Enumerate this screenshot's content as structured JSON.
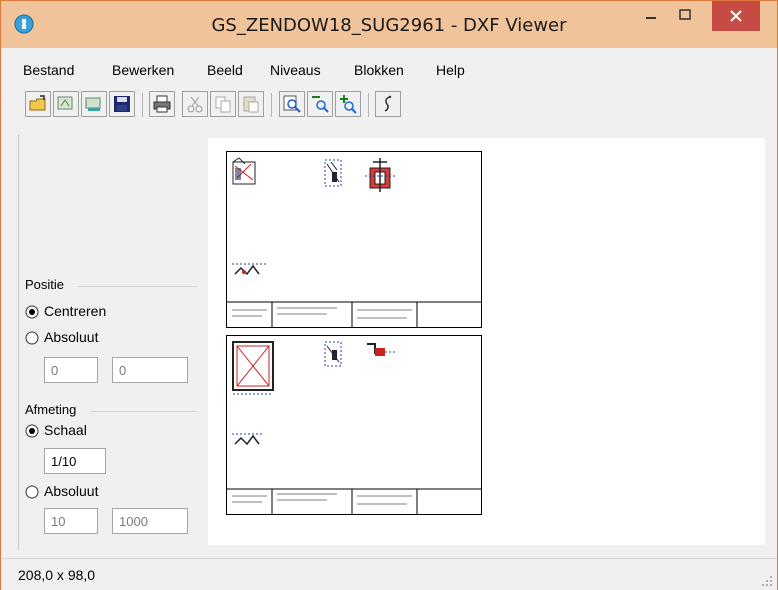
{
  "window": {
    "title": "GS_ZENDOW18_SUG2961 - DXF Viewer"
  },
  "menu": [
    "Bestand",
    "Bewerken",
    "Beeld",
    "Niveaus",
    "Blokken",
    "Help"
  ],
  "toolbar": {
    "buttons": [
      "open-icon",
      "cad-import-icon",
      "export-icon",
      "save-icon",
      "print-icon",
      "cut-icon",
      "copy-icon",
      "paste-icon",
      "zoom-window-icon",
      "zoom-out-icon",
      "zoom-in-icon",
      "info-icon"
    ]
  },
  "left_panel": {
    "positie": {
      "label": "Positie",
      "options": [
        "Centreren",
        "Absoluut"
      ],
      "selected": "Centreren",
      "x_value": "0",
      "y_value": "0"
    },
    "afmeting": {
      "label": "Afmeting",
      "options": [
        "Schaal",
        "Absoluut"
      ],
      "selected": "Schaal",
      "scale_value": "1/10",
      "width_value": "10",
      "height_value": "1000"
    }
  },
  "status": {
    "dimensions": "208,0 x 98,0"
  },
  "colors": {
    "titlebar": "#f0c39a",
    "close": "#c74b45",
    "border": "#e07a3c"
  }
}
